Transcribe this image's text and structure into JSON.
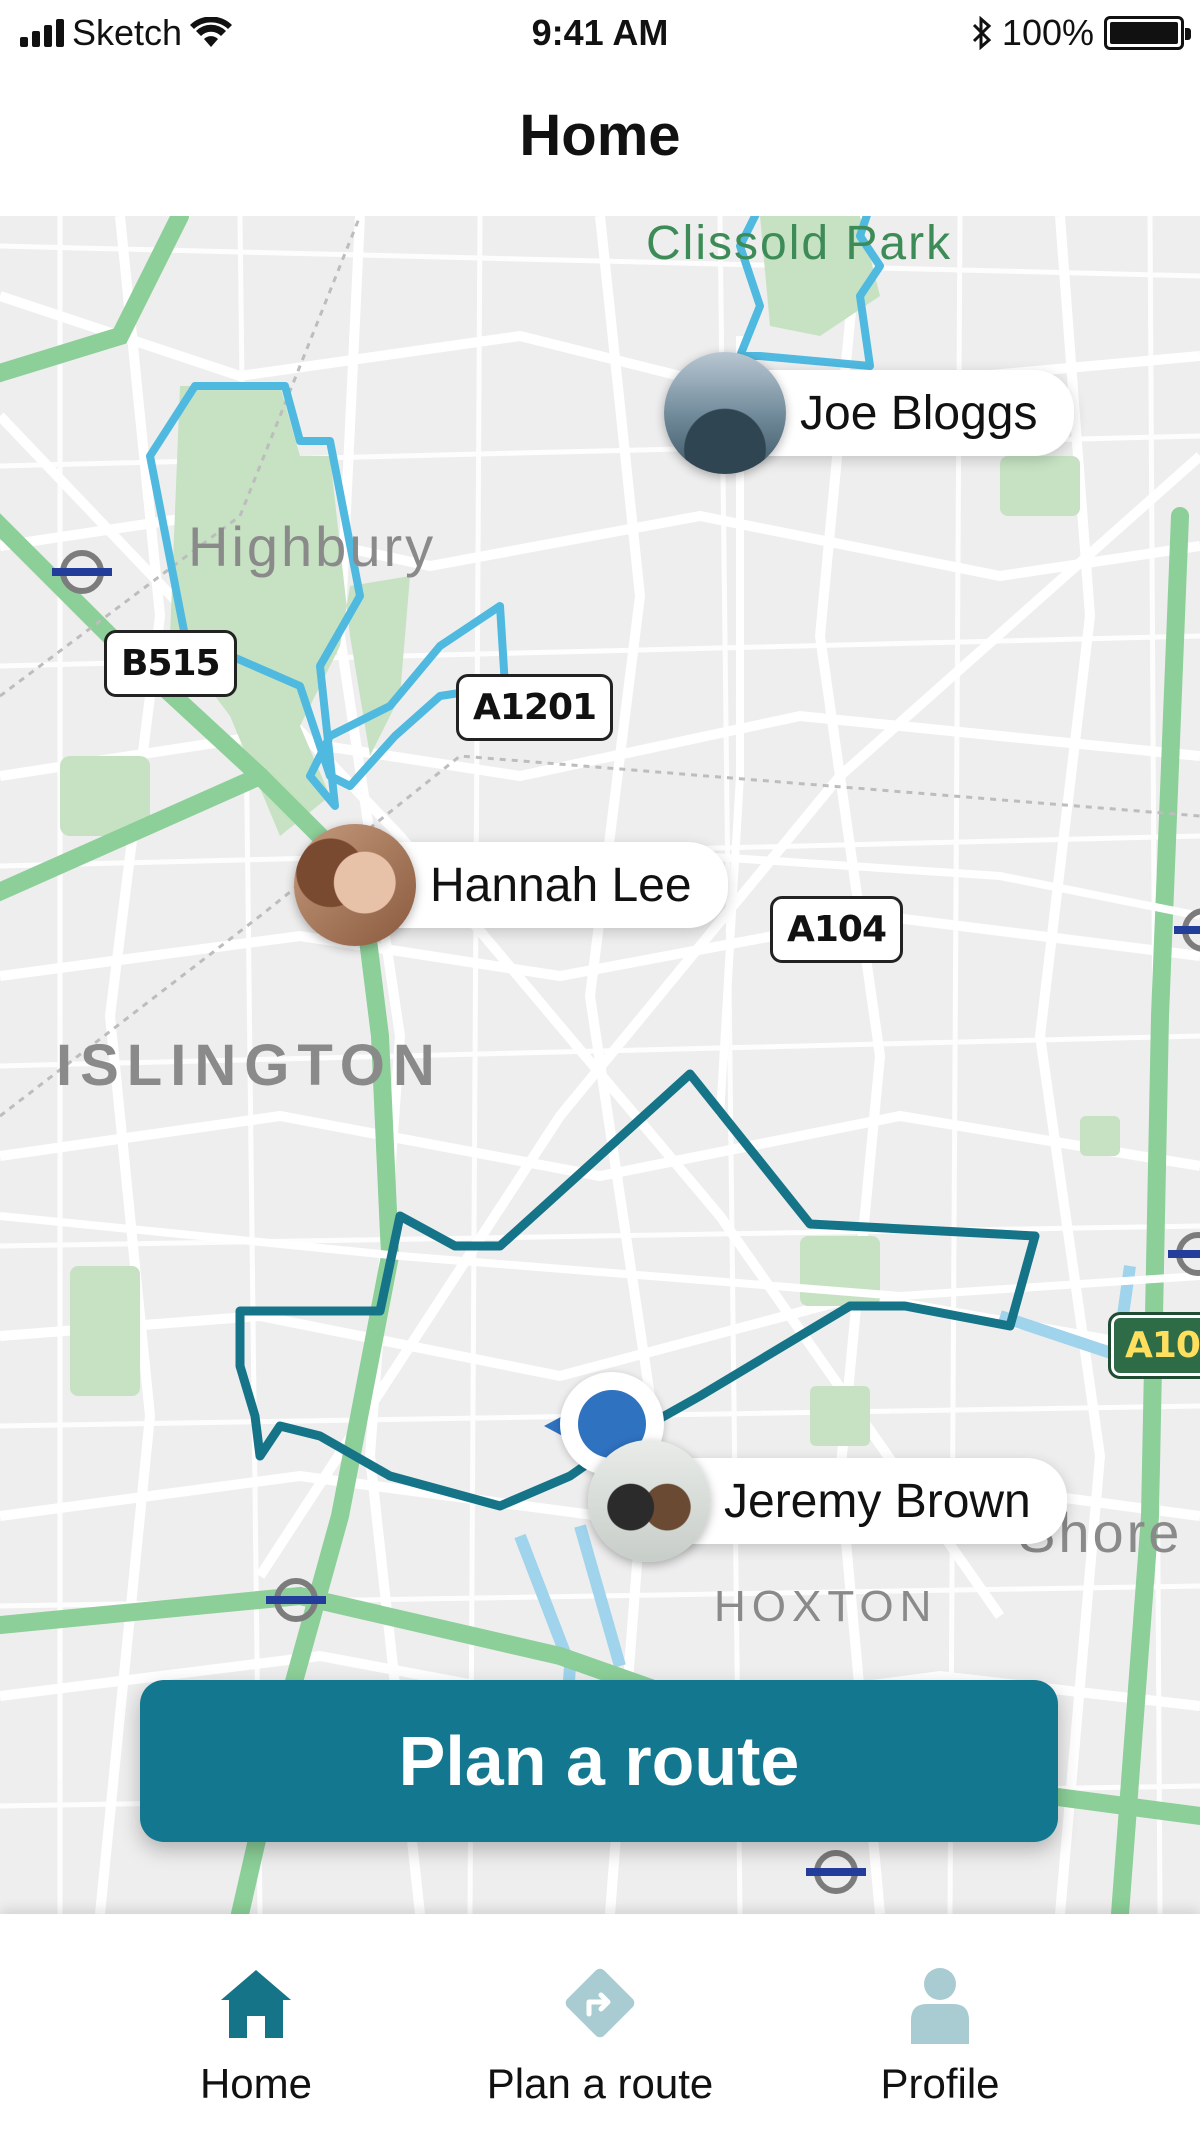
{
  "status_bar": {
    "carrier": "Sketch",
    "time": "9:41 AM",
    "battery": "100%",
    "battery_level": 1.0
  },
  "header": {
    "title": "Home"
  },
  "map": {
    "labels": {
      "park": "Clissold Park",
      "highbury": "Highbury",
      "islington": "ISLINGTON",
      "hoxton": "HOXTON",
      "shoreditch": "Shore"
    },
    "roads": {
      "b515": "B515",
      "a1201": "A1201",
      "a104": "A104",
      "a10": "A10"
    },
    "people": [
      {
        "name": "Joe Bloggs"
      },
      {
        "name": "Hannah Lee"
      },
      {
        "name": "Jeremy Brown"
      }
    ],
    "colors": {
      "route_light": "#4fb9e0",
      "route_dark": "#167489",
      "park_green": "#c6e2c3",
      "main_road": "#8ccf98",
      "water": "#9fd4ec"
    }
  },
  "primary_action": {
    "label": "Plan a route",
    "color": "#13788f"
  },
  "tab_bar": {
    "items": [
      {
        "label": "Home",
        "icon": "home-icon",
        "active": true
      },
      {
        "label": "Plan a route",
        "icon": "directions-icon",
        "active": false
      },
      {
        "label": "Profile",
        "icon": "person-icon",
        "active": false
      }
    ],
    "active_color": "#167489",
    "inactive_color": "#a9ccd2"
  }
}
